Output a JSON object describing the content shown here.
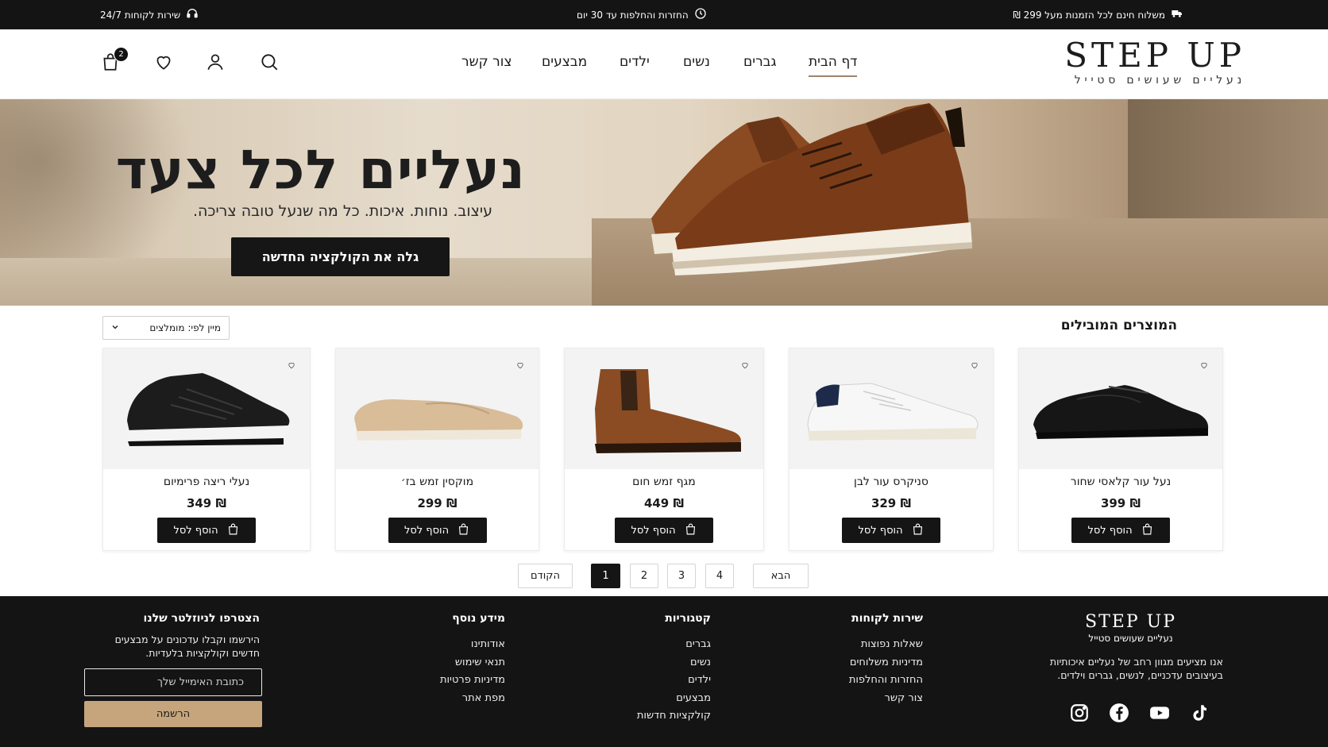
{
  "topbar": {
    "shipping": "משלוח חינם לכל הזמנות מעל 299 ₪",
    "returns": "החזרות והחלפות עד 30 יום",
    "service": "שירות לקוחות 24/7"
  },
  "header": {
    "logo_word": "STEP UP",
    "logo_tagline": "נעליים שעושים סטייל",
    "nav": [
      "דף הבית",
      "גברים",
      "נשים",
      "ילדים",
      "מבצעים",
      "צור קשר"
    ],
    "cart_count": "2"
  },
  "hero": {
    "title": "נעליים לכל צעד",
    "subtitle": "עיצוב. נוחות. איכות. כל מה שנעל טובה צריכה.",
    "cta": "גלה את הקולקציה החדשה"
  },
  "products_section": {
    "title": "המוצרים המובילים",
    "sort_label": "מיין לפי: מומלצים"
  },
  "products": [
    {
      "name": "נעל עור קלאסי שחור",
      "price": "₪ 399",
      "add": "הוסף לסל",
      "icon": "black-oxford-shoe"
    },
    {
      "name": "סניקרס עור לבן",
      "price": "₪ 329",
      "add": "הוסף לסל",
      "icon": "white-sneaker"
    },
    {
      "name": "מגף זמש חום",
      "price": "₪ 449",
      "add": "הוסף לסל",
      "icon": "brown-chelsea-boot"
    },
    {
      "name": "מוקסין זמש בז׳",
      "price": "₪ 299",
      "add": "הוסף לסל",
      "icon": "beige-loafer"
    },
    {
      "name": "נעלי ריצה פרימיום",
      "price": "₪ 349",
      "add": "הוסף לסל",
      "icon": "black-running-shoe"
    }
  ],
  "pagination": {
    "next": "הבא",
    "prev": "הקודם",
    "pages": [
      "4",
      "3",
      "2",
      "1"
    ],
    "current": "1"
  },
  "footer": {
    "logo_word": "STEP UP",
    "logo_tagline": "נעליים שעושים סטייל",
    "about": "אנו מציעים מגוון רחב של נעליים איכותיות בעיצובים עדכניים, לנשים, גברים וילדים.",
    "customer_service": {
      "title": "שירות לקוחות",
      "links": [
        "שאלות נפוצות",
        "מדיניות משלוחים",
        "החזרות והחלפות",
        "צור קשר"
      ]
    },
    "categories": {
      "title": "קטגוריות",
      "links": [
        "גברים",
        "נשים",
        "ילדים",
        "מבצעים",
        "קולקציות חדשות"
      ]
    },
    "more_info": {
      "title": "מידע נוסף",
      "links": [
        "אודותינו",
        "תנאי שימוש",
        "מדיניות פרטיות",
        "מפת אתר"
      ]
    },
    "newsletter": {
      "title": "הצטרפו לניוזלטר שלנו",
      "text": "הירשמו וקבלו עדכונים על מבצעים חדשים וקולקציות בלעדיות.",
      "placeholder": "כתובת האימייל שלך",
      "button": "הרשמה"
    },
    "social": [
      "instagram-icon",
      "facebook-icon",
      "youtube-icon",
      "tiktok-icon"
    ]
  },
  "colors": {
    "dark": "#141414",
    "accent": "#c6a57d",
    "nav_underline": "#a0826a"
  }
}
